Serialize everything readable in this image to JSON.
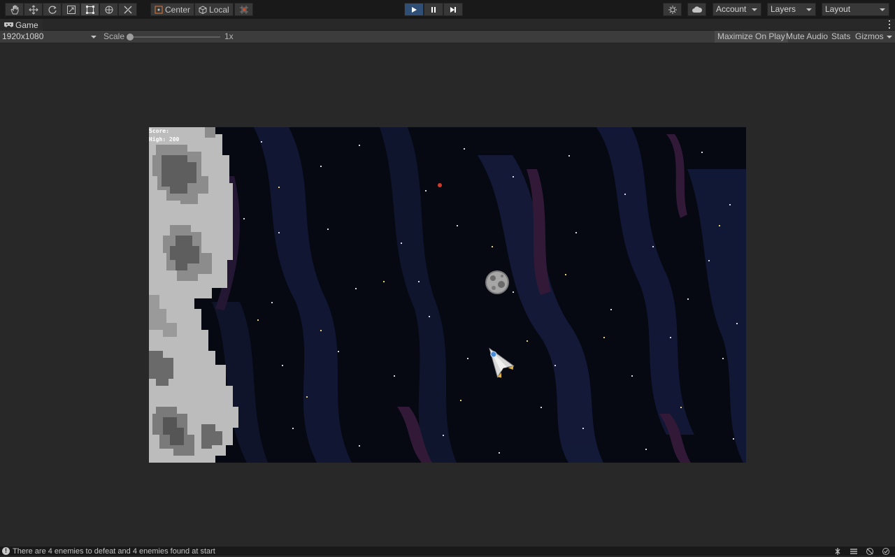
{
  "toolbar": {
    "tools": [
      "hand-tool",
      "move-tool",
      "rotate-tool",
      "scale-tool",
      "rect-tool",
      "transform-tool",
      "custom-editor-tool"
    ],
    "active_tool": "rect-tool",
    "pivot_mode": "Center",
    "pivot_rotation": "Local",
    "playmode": [
      "play",
      "pause",
      "step"
    ],
    "account_label": "Account",
    "layers_label": "Layers",
    "layout_label": "Layout"
  },
  "tab": {
    "label": "Game"
  },
  "gamebar": {
    "resolution": "1920x1080",
    "scale_label": "Scale",
    "scale_value": "1x",
    "scale_fraction": 0.0,
    "maximize_on_play": "Maximize On Play",
    "maximize_on_play_active": true,
    "mute_audio": "Mute Audio",
    "stats": "Stats",
    "gizmos": "Gizmos"
  },
  "game": {
    "hud": {
      "score": "Score:",
      "high": "High: 200"
    },
    "colors": {
      "space": "#060812",
      "nebula_blue": "#1c2448",
      "nebula_purple": "#3a1d3e",
      "moon_light": "#bcbcbc",
      "moon_dark": "#6a6a6a"
    }
  },
  "status": {
    "message": "There are 4 enemies to defeat and 4 enemies found at start",
    "icon": "info-icon"
  }
}
